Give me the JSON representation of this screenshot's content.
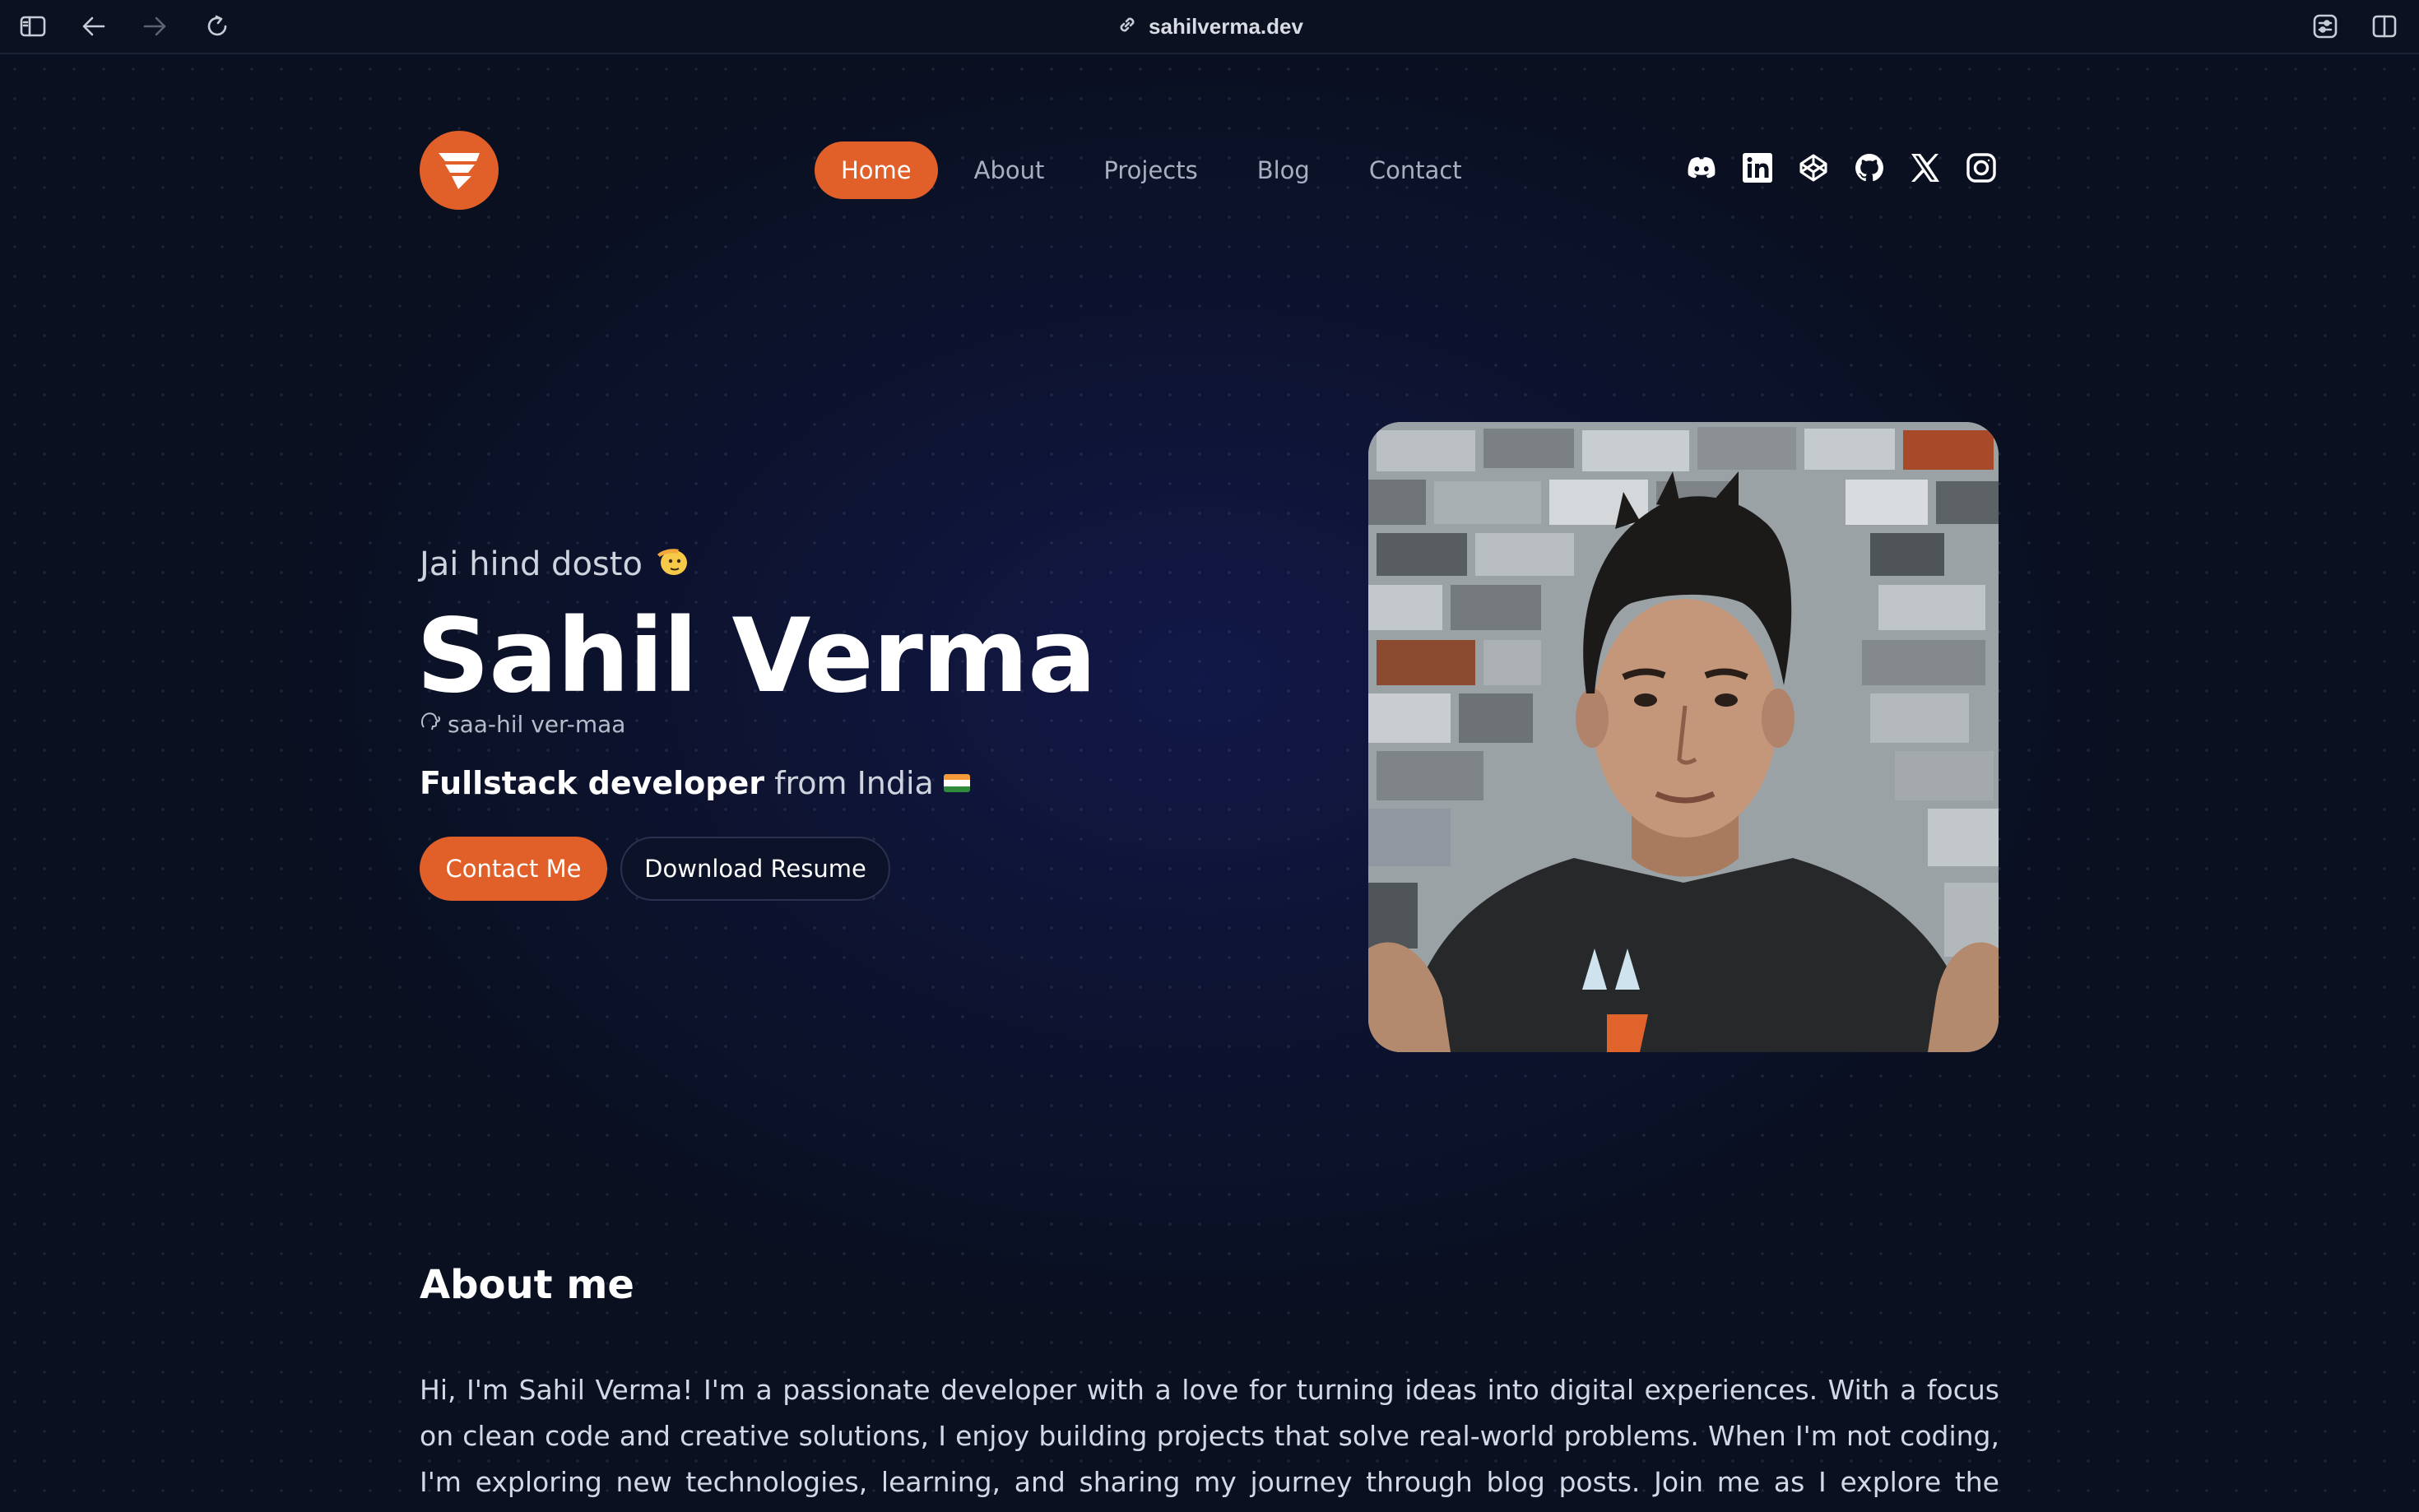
{
  "browser": {
    "url": "sahilverma.dev",
    "icons": [
      "sidebar-icon",
      "back-icon",
      "forward-icon",
      "reload-icon",
      "link-icon",
      "extension-icon",
      "split-view-icon"
    ]
  },
  "nav": {
    "items": [
      "Home",
      "About",
      "Projects",
      "Blog",
      "Contact"
    ],
    "active": "Home"
  },
  "socials": [
    "discord-icon",
    "linkedin-icon",
    "codepen-icon",
    "github-icon",
    "x-icon",
    "instagram-icon"
  ],
  "hero": {
    "greeting": "Jai hind dosto",
    "name": "Sahil Verma",
    "pronunciation": "saa-hil ver-maa",
    "role_bold": "Fullstack developer",
    "role_rest": "from India",
    "contact_button": "Contact Me",
    "resume_button": "Download Resume"
  },
  "about": {
    "title": "About me",
    "text": "Hi, I'm Sahil Verma! I'm a passionate developer with a love for turning ideas into digital experiences. With a focus on clean code and creative solutions, I enjoy building projects that solve real-world problems. When I'm not coding, I'm exploring new technologies, learning, and sharing my journey through blog posts. Join me as I explore the intersection of"
  },
  "colors": {
    "accent": "#e15f28",
    "background": "#0a1020"
  }
}
